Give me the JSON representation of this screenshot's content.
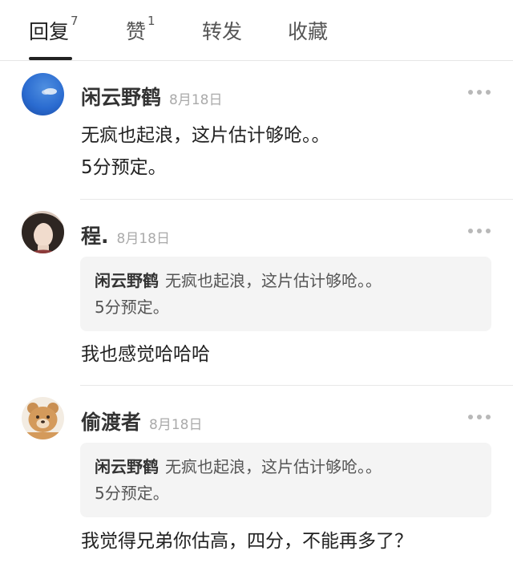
{
  "tabs": [
    {
      "label": "回复",
      "count": "7"
    },
    {
      "label": "赞",
      "count": "1"
    },
    {
      "label": "转发",
      "count": ""
    },
    {
      "label": "收藏",
      "count": ""
    }
  ],
  "comments": [
    {
      "author": "闲云野鹤",
      "date": "8月18日",
      "text": [
        "无疯也起浪，这片估计够呛。。",
        "5分预定。"
      ]
    },
    {
      "author": "程.",
      "date": "8月18日",
      "quote": {
        "author": "闲云野鹤",
        "text1": "无疯也起浪，这片估计够呛。。",
        "text2": "5分预定。"
      },
      "text": [
        "我也感觉哈哈哈"
      ]
    },
    {
      "author": "偷渡者",
      "date": "8月18日",
      "quote": {
        "author": "闲云野鹤",
        "text1": "无疯也起浪，这片估计够呛。。",
        "text2": "5分预定。"
      },
      "text": [
        "我觉得兄弟你估高，四分，不能再多了？"
      ]
    }
  ],
  "colors": {
    "accent": "#222222",
    "quote_bg": "#f4f4f4",
    "muted": "#aaaaaa"
  }
}
